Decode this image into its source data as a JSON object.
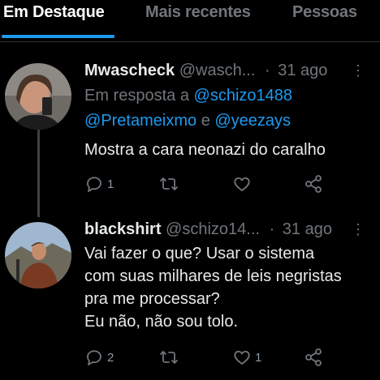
{
  "tabs": [
    {
      "label": "Em Destaque",
      "active": true
    },
    {
      "label": "Mais recentes",
      "active": false
    },
    {
      "label": "Pessoas",
      "active": false
    }
  ],
  "tweets": [
    {
      "name": "Mwascheck",
      "handle": "@wasch...",
      "date": "31 ago",
      "reply_prefix": "Em resposta a",
      "reply_user1": "@schizo1488",
      "reply_user2": "@Pretameixmo",
      "reply_and": "e",
      "reply_user3": "@yeezays",
      "text_lines": [
        "Mostra a cara neonazi do caralho"
      ],
      "reply_count": "1",
      "retweet_count": "",
      "like_count": ""
    },
    {
      "name": "blackshirt",
      "handle": "@schizo14...",
      "date": "31 ago",
      "text_lines": [
        "Vai fazer o que? Usar o sistema",
        "com suas milhares de leis negristas",
        "pra me processar?",
        "Eu não, não sou tolo."
      ],
      "reply_count": "2",
      "retweet_count": "",
      "like_count": "1"
    }
  ],
  "icons": {
    "reply": "reply-icon",
    "retweet": "retweet-icon",
    "like": "heart-icon",
    "share": "share-icon",
    "more": "more-icon"
  },
  "colors": {
    "background": "#000000",
    "accent": "#1d9bf0",
    "muted": "#71767b",
    "text": "#e7e9ea"
  }
}
